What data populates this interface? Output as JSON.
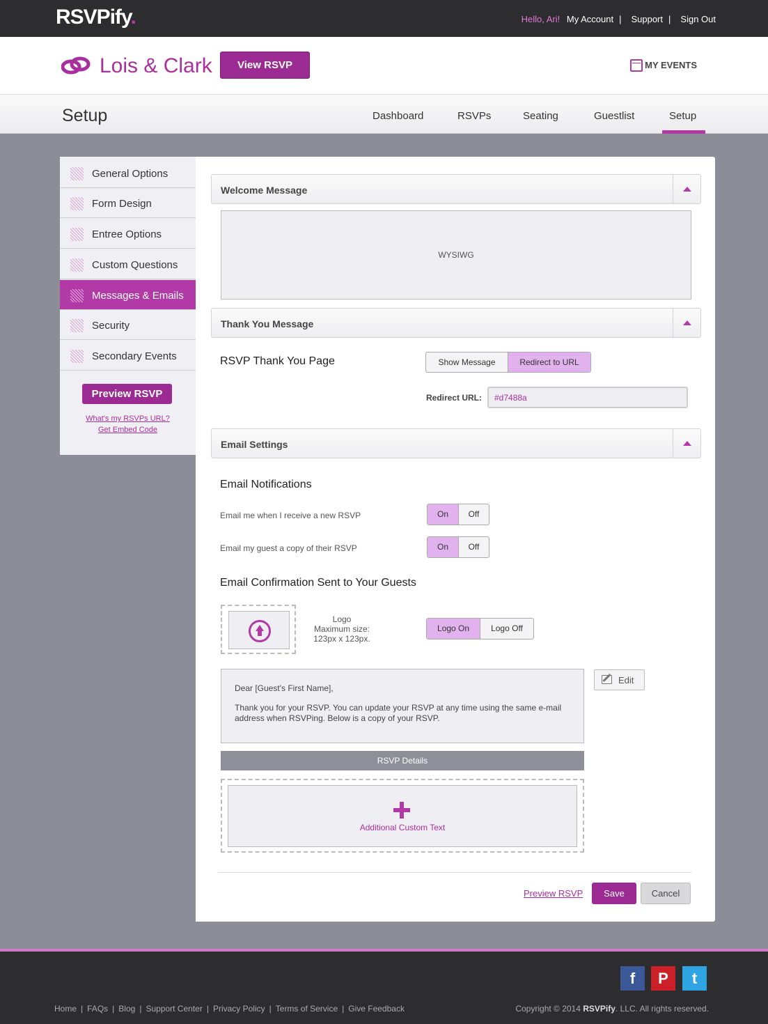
{
  "brand": {
    "name": "RSVPify",
    "dot": "."
  },
  "top_links": {
    "hello": "Hello, Ari!",
    "account": "My Account",
    "support": "Support",
    "signout": "Sign Out"
  },
  "event": {
    "title": "Lois & Clark",
    "view_rsvp": "View RSVP",
    "my_events": "MY EVENTS",
    "rings_icon": "rings-icon",
    "calendar_icon": "calendar-icon"
  },
  "subnav": {
    "page_title": "Setup",
    "tabs": [
      {
        "label": "Dashboard"
      },
      {
        "label": "RSVPs"
      },
      {
        "label": "Seating"
      },
      {
        "label": "Guestlist"
      },
      {
        "label": "Setup",
        "active": true
      }
    ]
  },
  "sidebar": {
    "items": [
      {
        "label": "General Options"
      },
      {
        "label": "Form Design"
      },
      {
        "label": "Entree Options"
      },
      {
        "label": "Custom Questions"
      },
      {
        "label": "Messages & Emails",
        "active": true
      },
      {
        "label": "Security"
      },
      {
        "label": "Secondary Events"
      }
    ],
    "preview_button": "Preview RSVP",
    "url_link": "What's my RSVPs URL?",
    "embed_link": "Get Embed Code"
  },
  "welcome": {
    "title": "Welcome Message",
    "editor_placeholder": "WYSIWG"
  },
  "thank_you": {
    "title": "Thank You Message",
    "page_label": "RSVP Thank You Page",
    "options": [
      "Show Message",
      "Redirect to URL"
    ],
    "selected": "Redirect to URL",
    "redirect_label": "Redirect URL:",
    "redirect_value": "#d7488a"
  },
  "email_settings": {
    "title": "Email Settings",
    "notifications_heading": "Email Notifications",
    "notify_new_rsvp": "Email me when I receive a new RSVP",
    "notify_guest_copy": "Email my guest a copy of their RSVP",
    "on_label": "On",
    "off_label": "Off",
    "confirmation_heading": "Email Confirmation Sent to Your Guests",
    "logo_info": {
      "line1": "Logo",
      "line2": "Maximum size:",
      "line3": "123px x 123px."
    },
    "logo_on": "Logo On",
    "logo_off": "Logo Off",
    "email_greeting": "Dear [Guest's First Name],",
    "email_body": "Thank you for your RSVP.  You can update your RSVP at any time using the same e-mail address when RSVPing.  Below is a copy of your RSVP.",
    "edit_button": "Edit",
    "details_bar": "RSVP Details",
    "custom_text": "Additional Custom Text"
  },
  "actions": {
    "preview": "Preview RSVP",
    "save": "Save",
    "cancel": "Cancel"
  },
  "footer": {
    "links": [
      "Home",
      "FAQs",
      "Blog",
      "Support Center",
      "Privacy Policy",
      "Terms of Service",
      "Give Feedback"
    ],
    "copyright_pre": "Copyright © 2014 ",
    "copyright_brand": "RSVPify",
    "copyright_post": ". LLC. All rights reserved.",
    "social": [
      {
        "icon": "facebook-icon",
        "glyph": "f",
        "color": "#3b5998"
      },
      {
        "icon": "pinterest-icon",
        "glyph": "P",
        "color": "#cb2027"
      },
      {
        "icon": "twitter-icon",
        "glyph": "t",
        "color": "#2fa4e2"
      }
    ]
  }
}
